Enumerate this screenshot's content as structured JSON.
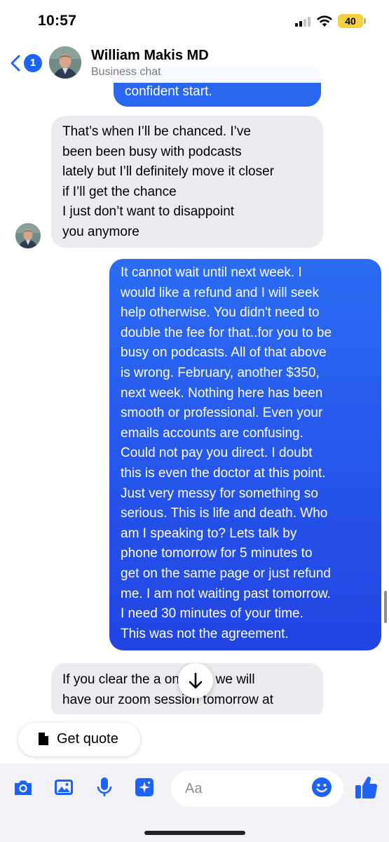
{
  "status_bar": {
    "time": "10:57",
    "battery": "40",
    "battery_color": "#f4d03f"
  },
  "header": {
    "back_badge": "1",
    "contact_name": "William Makis MD",
    "subtitle": "Business chat",
    "accent_color": "#1d63f5"
  },
  "messages": [
    {
      "direction": "outgoing",
      "partial": true,
      "text": "confident start."
    },
    {
      "direction": "incoming",
      "text": "That’s when I’ll be chanced.  I’ve\nbeen been busy with podcasts\nlately but I’ll definitely move it closer\nif I’ll get the chance\nI just don’t want to disappoint\nyou anymore"
    },
    {
      "direction": "outgoing",
      "text": "It cannot wait until next week.  I\nwould like a refund and I will seek\nhelp otherwise.   You didn't need to\ndouble the fee for that..for you to be\nbusy on podcasts.  All of that above\nis wrong.  February, another $350,\nnext week.   Nothing here has been\nsmooth or professional.  Even your\nemails accounts are confusing.\nCould not pay you direct.   I doubt\nthis is even the doctor at this point.\nJust very messy for something so\nserious. This is life and death.  Who\nam I speaking to?  Lets talk by\nphone tomorrow for 5 minutes to\nget on the same page or just refund\nme.  I am not waiting past tomorrow.\nI need 30 minutes of your time.\nThis was not the agreement."
    },
    {
      "direction": "incoming",
      "partial": true,
      "text": "If you clear the a          onal fee we will\nhave our zoom session tomorrow at"
    }
  ],
  "quick_reply": {
    "label": "Get quote",
    "icon": "document-icon"
  },
  "composer": {
    "placeholder": "Aa",
    "value": "",
    "tools": [
      "camera-icon",
      "gallery-icon",
      "microphone-icon",
      "ai-sparkle-icon"
    ],
    "tool_color": "#1d63f5"
  }
}
